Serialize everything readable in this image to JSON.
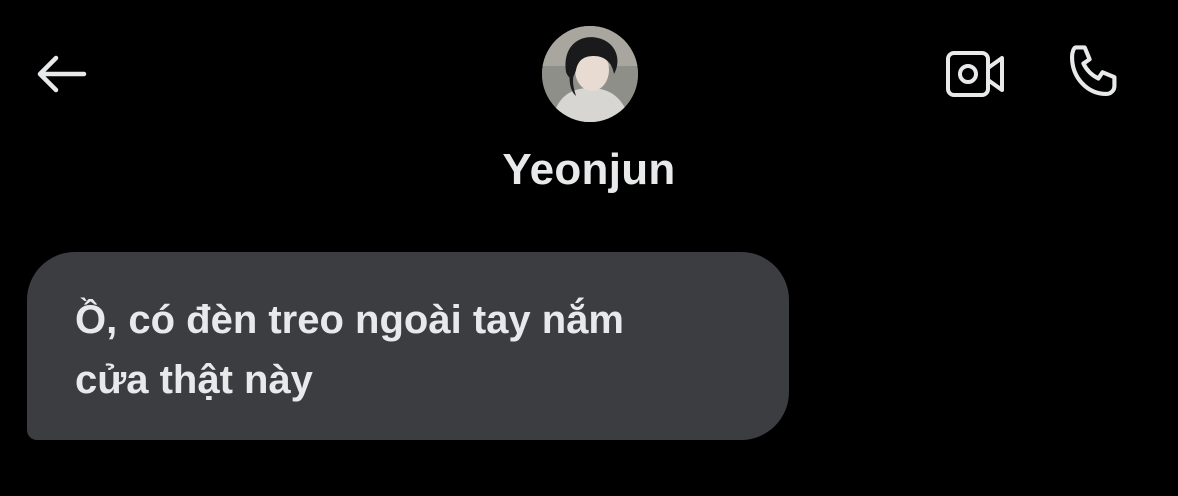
{
  "header": {
    "contact_name": "Yeonjun",
    "icons": {
      "back": "arrow-left-icon",
      "video": "video-camera-icon",
      "call": "phone-icon"
    }
  },
  "messages": [
    {
      "direction": "incoming",
      "line1": "Ồ, có đèn treo ngoài tay nắm",
      "line2": "cửa thật này"
    }
  ],
  "colors": {
    "background": "#000000",
    "bubble": "#3b3d40",
    "text": "#e7e9ea"
  }
}
